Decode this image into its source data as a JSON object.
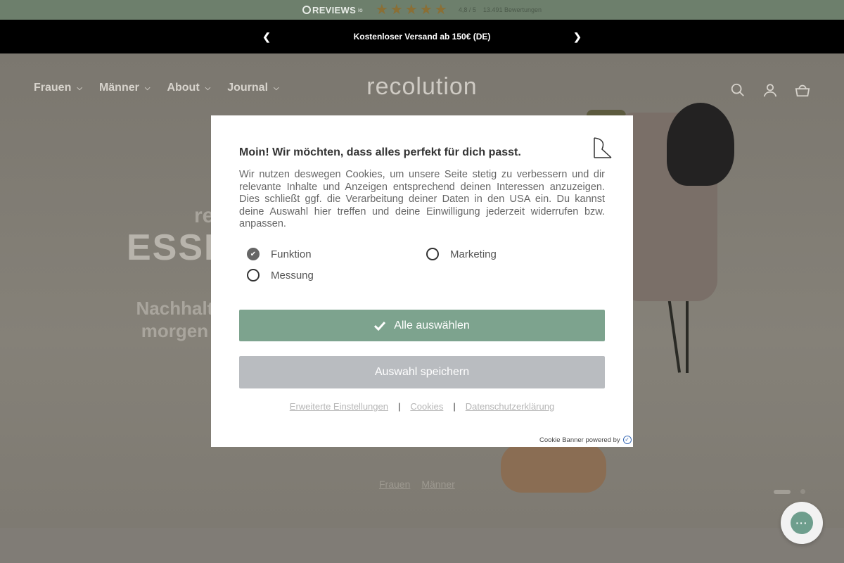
{
  "reviews": {
    "brand": "REVIEWS",
    "brand_suffix": "io",
    "rating": "4,8 / 5",
    "count": "13.491 Bewertungen",
    "stars_value": 4.5,
    "star_color": "#8a6f35"
  },
  "announcement": {
    "message": "Kostenloser Versand ab 150€ (DE)"
  },
  "nav": {
    "items": [
      {
        "label": "Frauen"
      },
      {
        "label": "Männer"
      },
      {
        "label": "About"
      },
      {
        "label": "Journal"
      }
    ]
  },
  "logo": "recolution",
  "header_icons": [
    "search-icon",
    "account-icon",
    "cart-icon"
  ],
  "hero": {
    "title_line1": "re",
    "title_line2": "ESSE",
    "subtitle_line1": "Nachhaltig",
    "subtitle_line2": "morgen u",
    "links": [
      "Frauen",
      "Männer"
    ]
  },
  "cookie": {
    "title": "Moin! Wir möchten, dass alles perfekt für dich passt.",
    "text": "Wir nutzen deswegen Cookies, um unsere Seite stetig zu verbessern und dir relevante Inhalte und Anzeigen entsprechend deinen Interessen anzuzeigen. Dies schließt ggf. die Verarbeitung deiner Daten in den USA ein. Du kannst deine Auswahl hier treffen und deine Einwilligung jederzeit widerrufen bzw. anpassen.",
    "options": {
      "funktion": "Funktion",
      "marketing": "Marketing",
      "messung": "Messung"
    },
    "accept_all": "Alle auswählen",
    "save": "Auswahl speichern",
    "links": {
      "advanced": "Erweiterte Einstellungen",
      "cookies": "Cookies",
      "privacy": "Datenschutzerklärung",
      "separator": "|"
    },
    "powered_by": "Cookie Banner powered by",
    "accent_color": "#7da38e"
  }
}
